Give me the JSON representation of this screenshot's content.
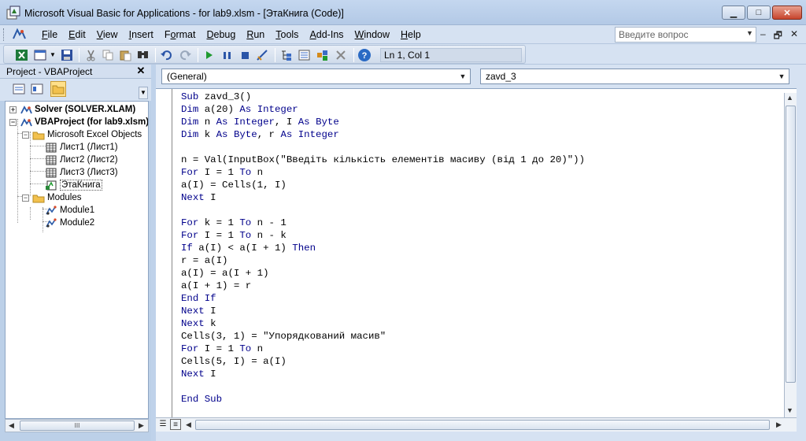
{
  "window": {
    "title": "Microsoft Visual Basic for Applications - for lab9.xlsm - [ЭтаКнига (Code)]",
    "minimize_glyph": "▁",
    "maximize_glyph": "□",
    "close_glyph": "✕"
  },
  "menu": {
    "items": [
      {
        "label": "File",
        "access": "F"
      },
      {
        "label": "Edit",
        "access": "E"
      },
      {
        "label": "View",
        "access": "V"
      },
      {
        "label": "Insert",
        "access": "I"
      },
      {
        "label": "Format",
        "access": "o"
      },
      {
        "label": "Debug",
        "access": "D"
      },
      {
        "label": "Run",
        "access": "R"
      },
      {
        "label": "Tools",
        "access": "T"
      },
      {
        "label": "Add-Ins",
        "access": "A"
      },
      {
        "label": "Window",
        "access": "W"
      },
      {
        "label": "Help",
        "access": "H"
      }
    ],
    "help_placeholder": "Введите вопрос",
    "mdi_minimize": "–",
    "mdi_restore": "🗗",
    "mdi_close": "✕"
  },
  "toolbar": {
    "position": "Ln 1, Col 1"
  },
  "project": {
    "title": "Project - VBAProject",
    "close_glyph": "✕",
    "tree": [
      {
        "label": "Solver (SOLVER.XLAM)",
        "bold": true,
        "expander": "+",
        "icon": "vbaproject-icon"
      },
      {
        "label": "VBAProject (for lab9.xlsm)",
        "bold": true,
        "expander": "−",
        "icon": "vbaproject-icon"
      },
      {
        "label": "Microsoft Excel Objects",
        "bold": false,
        "expander": "−",
        "icon": "folder-icon"
      },
      {
        "label": "Лист1 (Лист1)",
        "bold": false,
        "expander": "",
        "icon": "sheet-icon"
      },
      {
        "label": "Лист2 (Лист2)",
        "bold": false,
        "expander": "",
        "icon": "sheet-icon"
      },
      {
        "label": "Лист3 (Лист3)",
        "bold": false,
        "expander": "",
        "icon": "sheet-icon"
      },
      {
        "label": "ЭтаКнига",
        "bold": false,
        "expander": "",
        "icon": "workbook-icon",
        "selected": true
      },
      {
        "label": "Modules",
        "bold": false,
        "expander": "−",
        "icon": "folder-icon"
      },
      {
        "label": "Module1",
        "bold": false,
        "expander": "",
        "icon": "module-icon"
      },
      {
        "label": "Module2",
        "bold": false,
        "expander": "",
        "icon": "module-icon"
      }
    ],
    "scroll_grip": "III"
  },
  "code": {
    "object_combo": "(General)",
    "procedure_combo": "zavd_3",
    "lines": [
      [
        {
          "t": "Sub",
          "k": 1
        },
        {
          "t": " zavd_3()"
        }
      ],
      [
        {
          "t": "Dim",
          "k": 1
        },
        {
          "t": " a(20) "
        },
        {
          "t": "As",
          "k": 1
        },
        {
          "t": " "
        },
        {
          "t": "Integer",
          "k": 1
        }
      ],
      [
        {
          "t": "Dim",
          "k": 1
        },
        {
          "t": " n "
        },
        {
          "t": "As",
          "k": 1
        },
        {
          "t": " "
        },
        {
          "t": "Integer",
          "k": 1
        },
        {
          "t": ", I "
        },
        {
          "t": "As",
          "k": 1
        },
        {
          "t": " "
        },
        {
          "t": "Byte",
          "k": 1
        }
      ],
      [
        {
          "t": "Dim",
          "k": 1
        },
        {
          "t": " k "
        },
        {
          "t": "As",
          "k": 1
        },
        {
          "t": " "
        },
        {
          "t": "Byte",
          "k": 1
        },
        {
          "t": ", r "
        },
        {
          "t": "As",
          "k": 1
        },
        {
          "t": " "
        },
        {
          "t": "Integer",
          "k": 1
        }
      ],
      [],
      [
        {
          "t": "n = Val(InputBox(\"Введіть кількість елементів масиву (від 1 до 20)\"))"
        }
      ],
      [
        {
          "t": "For",
          "k": 1
        },
        {
          "t": " I = 1 "
        },
        {
          "t": "To",
          "k": 1
        },
        {
          "t": " n"
        }
      ],
      [
        {
          "t": "a(I) = Cells(1, I)"
        }
      ],
      [
        {
          "t": "Next",
          "k": 1
        },
        {
          "t": " I"
        }
      ],
      [],
      [
        {
          "t": "For",
          "k": 1
        },
        {
          "t": " k = 1 "
        },
        {
          "t": "To",
          "k": 1
        },
        {
          "t": " n - 1"
        }
      ],
      [
        {
          "t": "For",
          "k": 1
        },
        {
          "t": " I = 1 "
        },
        {
          "t": "To",
          "k": 1
        },
        {
          "t": " n - k"
        }
      ],
      [
        {
          "t": "If",
          "k": 1
        },
        {
          "t": " a(I) < a(I + 1) "
        },
        {
          "t": "Then",
          "k": 1
        }
      ],
      [
        {
          "t": "r = a(I)"
        }
      ],
      [
        {
          "t": "a(I) = a(I + 1)"
        }
      ],
      [
        {
          "t": "a(I + 1) = r"
        }
      ],
      [
        {
          "t": "End If",
          "k": 1
        }
      ],
      [
        {
          "t": "Next",
          "k": 1
        },
        {
          "t": " I"
        }
      ],
      [
        {
          "t": "Next",
          "k": 1
        },
        {
          "t": " k"
        }
      ],
      [
        {
          "t": "Cells(3, 1) = \"Упорядкований масив\""
        }
      ],
      [
        {
          "t": "For",
          "k": 1
        },
        {
          "t": " I = 1 "
        },
        {
          "t": "To",
          "k": 1
        },
        {
          "t": " n"
        }
      ],
      [
        {
          "t": "Cells(5, I) = a(I)"
        }
      ],
      [
        {
          "t": "Next",
          "k": 1
        },
        {
          "t": " I"
        }
      ],
      [],
      [
        {
          "t": "End Sub",
          "k": 1
        }
      ]
    ]
  },
  "colors": {
    "keyword": "#00008b",
    "text": "#000000",
    "chrome": "#d6e2f2"
  }
}
